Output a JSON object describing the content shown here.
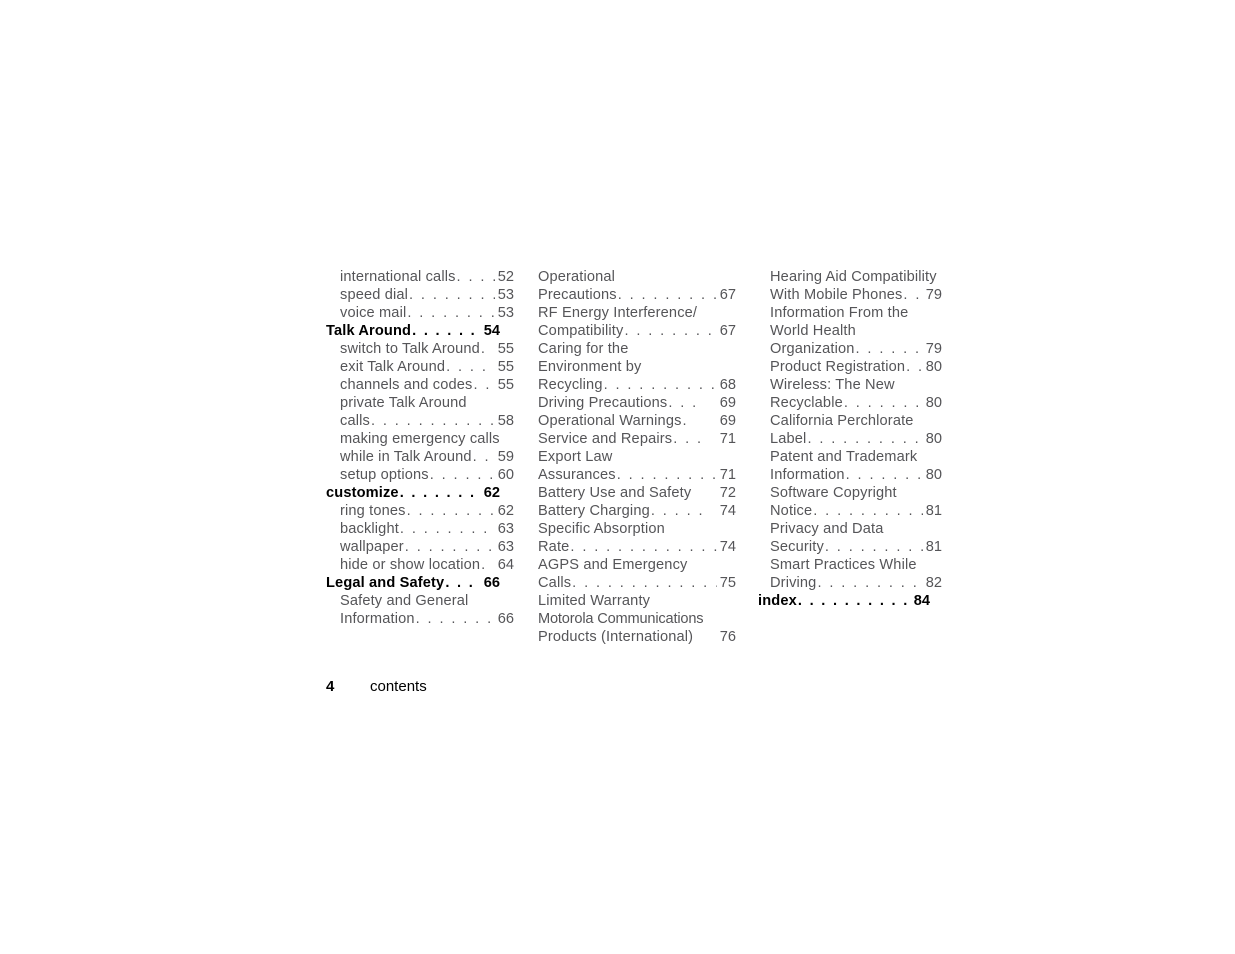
{
  "document": {
    "footer": {
      "page_number": "4",
      "title": "contents"
    }
  },
  "columns": [
    {
      "id": "column-1",
      "entries": [
        {
          "label": "international calls",
          "leader": ". . . . .",
          "page": "52",
          "level": "sub",
          "bold": false
        },
        {
          "label": "speed dial",
          "leader": ". . . . . . . . .",
          "page": "53",
          "level": "sub",
          "bold": false
        },
        {
          "label": "voice mail",
          "leader": ". . . . . . . . .",
          "page": "53",
          "level": "sub",
          "bold": false
        },
        {
          "label": "Talk Around",
          "leader": ". . . . . . . . .",
          "page": "54",
          "level": "head",
          "bold": true
        },
        {
          "label": "switch to Talk Around",
          "leader": ".",
          "page": "55",
          "level": "sub",
          "bold": false
        },
        {
          "label": "exit Talk Around",
          "leader": ". . . . . .",
          "page": "55",
          "level": "sub",
          "bold": false
        },
        {
          "label": "channels and codes",
          "leader": ". . .",
          "page": "55",
          "level": "sub",
          "bold": false
        },
        {
          "label": "private Talk Around",
          "leader": "",
          "page": "",
          "level": "sub",
          "bold": false,
          "wrap": true
        },
        {
          "label": "calls",
          "leader": ". . . . . . . . . . . . .",
          "page": "58",
          "level": "sub",
          "bold": false
        },
        {
          "label": "making emergency calls",
          "leader": "",
          "page": "",
          "level": "sub",
          "bold": false,
          "wrap": true
        },
        {
          "label": "while in Talk Around",
          "leader": ". .",
          "page": "59",
          "level": "sub",
          "bold": false
        },
        {
          "label": "setup options",
          "leader": ". . . . . . . .",
          "page": "60",
          "level": "sub",
          "bold": false
        },
        {
          "label": "customize",
          "leader": ". . . . . . . . . . . .",
          "page": "62",
          "level": "head",
          "bold": true
        },
        {
          "label": "ring tones",
          "leader": ". . . . . . . . .",
          "page": "62",
          "level": "sub",
          "bold": false
        },
        {
          "label": "backlight",
          "leader": ". . . . . . . . . . .",
          "page": "63",
          "level": "sub",
          "bold": false
        },
        {
          "label": "wallpaper",
          "leader": ". . . . . . . . . . .",
          "page": "63",
          "level": "sub",
          "bold": false
        },
        {
          "label": "hide or show location",
          "leader": ".",
          "page": "64",
          "level": "sub",
          "bold": false
        },
        {
          "label": "Legal and Safety",
          "leader": ". . . . . .",
          "page": "66",
          "level": "head",
          "bold": true
        },
        {
          "label": "Safety and General",
          "leader": "",
          "page": "",
          "level": "sub",
          "bold": false,
          "wrap": true
        },
        {
          "label": "Information",
          "leader": ". . . . . . . . .",
          "page": "66",
          "level": "sub",
          "bold": false
        }
      ]
    },
    {
      "id": "column-2",
      "entries": [
        {
          "label": "Operational",
          "leader": "",
          "page": "",
          "level": "flush",
          "bold": false,
          "wrap": true
        },
        {
          "label": "Precautions",
          "leader": ". . . . . . . . .",
          "page": "67",
          "level": "flush",
          "bold": false
        },
        {
          "label": "RF Energy Interference/",
          "leader": "",
          "page": "",
          "level": "flush",
          "bold": false,
          "wrap": true
        },
        {
          "label": "Compatibility",
          "leader": ". . . . . . . .",
          "page": "67",
          "level": "flush",
          "bold": false
        },
        {
          "label": "Caring for the",
          "leader": "",
          "page": "",
          "level": "flush",
          "bold": false,
          "wrap": true
        },
        {
          "label": "Environment by",
          "leader": "",
          "page": "",
          "level": "flush",
          "bold": false,
          "wrap": true
        },
        {
          "label": "Recycling",
          "leader": ". . . . . . . . . . .",
          "page": "68",
          "level": "flush",
          "bold": false
        },
        {
          "label": "Driving Precautions",
          "leader": ". . .",
          "page": "69",
          "level": "flush",
          "bold": false
        },
        {
          "label": "Operational Warnings",
          "leader": ".",
          "page": "69",
          "level": "flush",
          "bold": false
        },
        {
          "label": "Service and Repairs",
          "leader": ". . .",
          "page": "71",
          "level": "flush",
          "bold": false
        },
        {
          "label": "Export Law",
          "leader": "",
          "page": "",
          "level": "flush",
          "bold": false,
          "wrap": true
        },
        {
          "label": "Assurances",
          "leader": ". . . . . . . . .",
          "page": "71",
          "level": "flush",
          "bold": false
        },
        {
          "label": "Battery Use and Safety",
          "leader": "",
          "page": "72",
          "level": "flush",
          "bold": false
        },
        {
          "label": "Battery Charging",
          "leader": ". . . . .",
          "page": "74",
          "level": "flush",
          "bold": false
        },
        {
          "label": "Specific Absorption",
          "leader": "",
          "page": "",
          "level": "flush",
          "bold": false,
          "wrap": true
        },
        {
          "label": "Rate",
          "leader": ". . . . . . . . . . . . .",
          "page": "74",
          "level": "flush",
          "bold": false
        },
        {
          "label": "AGPS and Emergency",
          "leader": "",
          "page": "",
          "level": "flush",
          "bold": false,
          "wrap": true
        },
        {
          "label": "Calls",
          "leader": ". . . . . . . . . . . . .",
          "page": "75",
          "level": "flush",
          "bold": false
        },
        {
          "label": "Limited Warranty",
          "leader": "",
          "page": "",
          "level": "flush",
          "bold": false,
          "wrap": true
        },
        {
          "label": "Motorola Communications",
          "leader": "",
          "page": "",
          "level": "flush",
          "bold": false,
          "wrap": true,
          "condensed": true
        },
        {
          "label": "Products (International)",
          "leader": "",
          "page": "76",
          "level": "flush",
          "bold": false
        }
      ]
    },
    {
      "id": "column-3",
      "entries": [
        {
          "label": "Hearing Aid Compatibility",
          "leader": "",
          "page": "",
          "level": "flush",
          "bold": false,
          "wrap": true
        },
        {
          "label": "With Mobile Phones",
          "leader": ". .",
          "page": "79",
          "level": "flush",
          "bold": false
        },
        {
          "label": "Information From the",
          "leader": "",
          "page": "",
          "level": "flush",
          "bold": false,
          "wrap": true
        },
        {
          "label": "World Health",
          "leader": "",
          "page": "",
          "level": "flush",
          "bold": false,
          "wrap": true
        },
        {
          "label": "Organization",
          "leader": ". . . . . . .",
          "page": "79",
          "level": "flush",
          "bold": false
        },
        {
          "label": "Product Registration",
          "leader": ". .",
          "page": "80",
          "level": "flush",
          "bold": false
        },
        {
          "label": "Wireless: The New",
          "leader": "",
          "page": "",
          "level": "flush",
          "bold": false,
          "wrap": true
        },
        {
          "label": "Recyclable",
          "leader": ". . . . . . . . .",
          "page": "80",
          "level": "flush",
          "bold": false
        },
        {
          "label": "California Perchlorate",
          "leader": "",
          "page": "",
          "level": "flush",
          "bold": false,
          "wrap": true
        },
        {
          "label": "Label",
          "leader": ". . . . . . . . . . . .",
          "page": "80",
          "level": "flush",
          "bold": false
        },
        {
          "label": "Patent and Trademark",
          "leader": "",
          "page": "",
          "level": "flush",
          "bold": false,
          "wrap": true
        },
        {
          "label": "Information",
          "leader": ". . . . . . . . .",
          "page": "80",
          "level": "flush",
          "bold": false
        },
        {
          "label": "Software Copyright",
          "leader": "",
          "page": "",
          "level": "flush",
          "bold": false,
          "wrap": true
        },
        {
          "label": "Notice",
          "leader": ". . . . . . . . . . . .",
          "page": "81",
          "level": "flush",
          "bold": false
        },
        {
          "label": "Privacy and Data",
          "leader": "",
          "page": "",
          "level": "flush",
          "bold": false,
          "wrap": true
        },
        {
          "label": "Security",
          "leader": ". . . . . . . . . . .",
          "page": "81",
          "level": "flush",
          "bold": false
        },
        {
          "label": "Smart Practices While",
          "leader": "",
          "page": "",
          "level": "flush",
          "bold": false,
          "wrap": true
        },
        {
          "label": "Driving",
          "leader": ". . . . . . . . . . . .",
          "page": "82",
          "level": "flush",
          "bold": false
        },
        {
          "label": "index",
          "leader": ". . . . . . . . . . . . . .",
          "page": "84",
          "level": "head",
          "bold": true,
          "outdent": true
        }
      ]
    }
  ],
  "colors": {
    "page_background": "#ffffff",
    "body_text": "#555558",
    "heading_text": "#000000",
    "footer_text": "#000000"
  }
}
